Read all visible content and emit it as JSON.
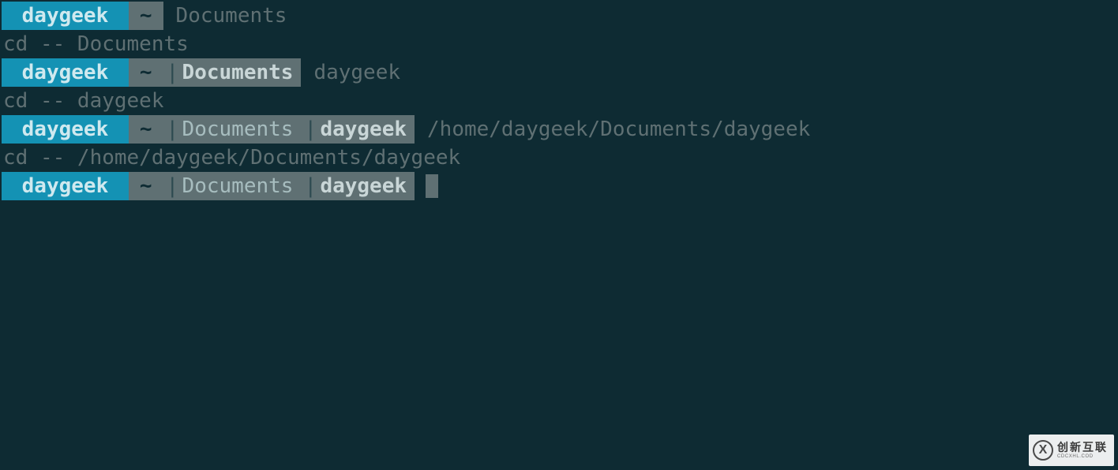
{
  "colors": {
    "bg": "#0e2b33",
    "accent": "#1492b4",
    "segment_bg": "#5f7073",
    "dim_text": "#5f7073"
  },
  "lines": [
    {
      "type": "prompt",
      "user": "daygeek",
      "tilde": "~",
      "segments": [],
      "trailing": "Documents"
    },
    {
      "type": "echo",
      "text": "cd -- Documents"
    },
    {
      "type": "prompt",
      "user": "daygeek",
      "tilde": "~",
      "segments": [
        {
          "label": "Documents",
          "bold": true
        }
      ],
      "trailing": "daygeek"
    },
    {
      "type": "echo",
      "text": "cd -- daygeek"
    },
    {
      "type": "prompt",
      "user": "daygeek",
      "tilde": "~",
      "segments": [
        {
          "label": "Documents",
          "bold": false
        },
        {
          "label": "daygeek",
          "bold": true
        }
      ],
      "trailing": "/home/daygeek/Documents/daygeek"
    },
    {
      "type": "echo",
      "text": "cd -- /home/daygeek/Documents/daygeek"
    },
    {
      "type": "prompt",
      "user": "daygeek",
      "tilde": "~",
      "segments": [
        {
          "label": "Documents",
          "bold": false
        },
        {
          "label": "daygeek",
          "bold": true
        }
      ],
      "trailing": "",
      "cursor": true
    }
  ],
  "sep": "|",
  "watermark": {
    "glyph": "X",
    "title": "创新互联",
    "subtitle": "CDCXHL.COD"
  }
}
